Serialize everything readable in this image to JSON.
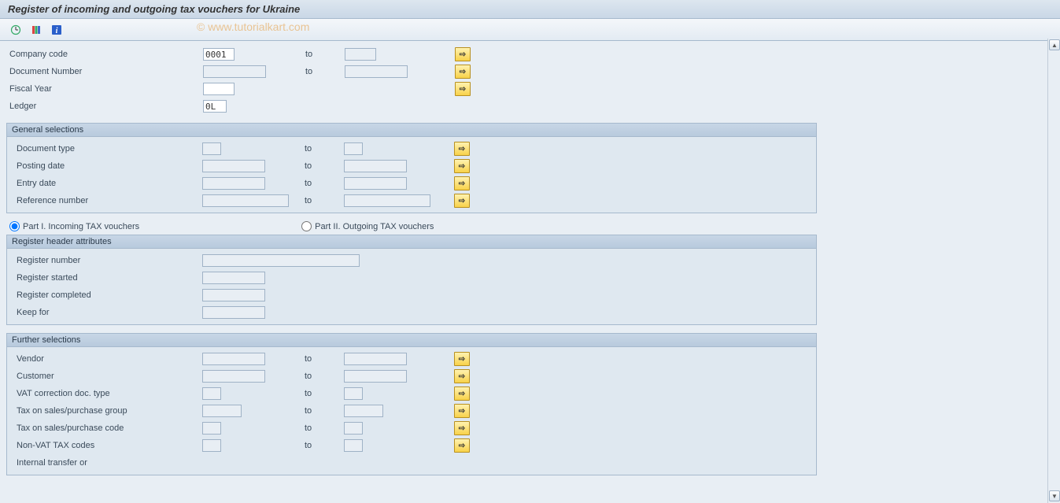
{
  "title": "Register of incoming and outgoing tax vouchers for Ukraine",
  "watermark": "© www.tutorialkart.com",
  "top": {
    "company_code": {
      "label": "Company code",
      "from": "0001",
      "to": ""
    },
    "document_number": {
      "label": "Document Number",
      "from": "",
      "to": ""
    },
    "fiscal_year": {
      "label": "Fiscal Year",
      "value": ""
    },
    "ledger": {
      "label": "Ledger",
      "value": "0L"
    },
    "to_label": "to"
  },
  "general": {
    "title": "General selections",
    "document_type": {
      "label": "Document type",
      "from": "",
      "to": ""
    },
    "posting_date": {
      "label": "Posting date",
      "from": "",
      "to": ""
    },
    "entry_date": {
      "label": "Entry date",
      "from": "",
      "to": ""
    },
    "reference_number": {
      "label": "Reference number",
      "from": "",
      "to": ""
    }
  },
  "parts": {
    "part1": "Part I. Incoming TAX vouchers",
    "part2": "Part II. Outgoing TAX vouchers",
    "selected": "part1"
  },
  "header_attrs": {
    "title": "Register header attributes",
    "register_number": {
      "label": "Register number",
      "value": ""
    },
    "register_started": {
      "label": "Register started",
      "value": ""
    },
    "register_completed": {
      "label": "Register completed",
      "value": ""
    },
    "keep_for": {
      "label": "Keep for",
      "value": ""
    }
  },
  "further": {
    "title": "Further selections",
    "vendor": {
      "label": "Vendor",
      "from": "",
      "to": ""
    },
    "customer": {
      "label": "Customer",
      "from": "",
      "to": ""
    },
    "vat_corr_type": {
      "label": "VAT correction doc. type",
      "from": "",
      "to": ""
    },
    "tax_group": {
      "label": "Tax on sales/purchase group",
      "from": "",
      "to": ""
    },
    "tax_code": {
      "label": "Tax on sales/purchase code",
      "from": "",
      "to": ""
    },
    "non_vat": {
      "label": "Non-VAT TAX codes",
      "from": "",
      "to": ""
    },
    "internal_transfer": {
      "label": "Internal transfer or"
    }
  }
}
